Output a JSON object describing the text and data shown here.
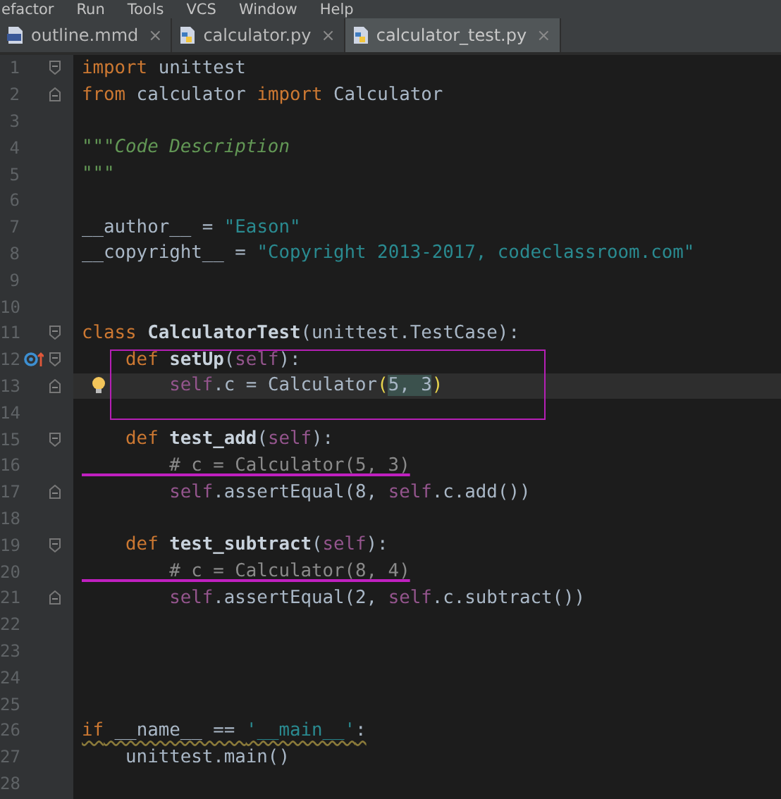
{
  "menu": [
    "efactor",
    "Run",
    "Tools",
    "VCS",
    "Window",
    "Help"
  ],
  "tabs": [
    {
      "label": "outline.mmd",
      "close": "×",
      "selected": false
    },
    {
      "label": "calculator.py",
      "close": "×",
      "selected": false
    },
    {
      "label": "calculator_test.py",
      "close": "×",
      "selected": true
    }
  ],
  "editor": {
    "lines": [
      {
        "number": "1",
        "fold_start": true,
        "tokens": [
          {
            "text": "import",
            "kind": "keyword"
          },
          {
            "text": " unittest",
            "kind": "plain"
          }
        ]
      },
      {
        "number": "2",
        "fold_end": true,
        "tokens": [
          {
            "text": "from",
            "kind": "keyword"
          },
          {
            "text": " calculator ",
            "kind": "plain"
          },
          {
            "text": "import",
            "kind": "keyword"
          },
          {
            "text": " Calculator",
            "kind": "plain"
          }
        ]
      },
      {
        "number": "3"
      },
      {
        "number": "4",
        "tokens": [
          {
            "text": "\"\"\"Code Description",
            "kind": "docstring"
          }
        ]
      },
      {
        "number": "5",
        "tokens": [
          {
            "text": "\"\"\"",
            "kind": "docstring"
          }
        ]
      },
      {
        "number": "6"
      },
      {
        "number": "7",
        "tokens": [
          {
            "text": "__author__ = ",
            "kind": "plain"
          },
          {
            "text": "\"Eason\"",
            "kind": "string"
          }
        ]
      },
      {
        "number": "8",
        "tokens": [
          {
            "text": "__copyright__ = ",
            "kind": "plain"
          },
          {
            "text": "\"Copyright 2013-2017, codeclassroom.com\"",
            "kind": "string"
          }
        ]
      },
      {
        "number": "9"
      },
      {
        "number": "10"
      },
      {
        "number": "11",
        "fold_start": true,
        "tokens": [
          {
            "text": "class",
            "kind": "keyword"
          },
          {
            "text": " CalculatorTest",
            "kind": "name"
          },
          {
            "text": "(unittest.TestCase):",
            "kind": "plain"
          }
        ]
      },
      {
        "number": "12",
        "fold_start": true,
        "override_marker": true,
        "boxed": true,
        "tokens": [
          {
            "text": "    def",
            "kind": "keyword"
          },
          {
            "text": " setUp",
            "kind": "name"
          },
          {
            "text": "(",
            "kind": "plain"
          },
          {
            "text": "self",
            "kind": "self"
          },
          {
            "text": "):",
            "kind": "plain"
          }
        ]
      },
      {
        "number": "13",
        "fold_end": true,
        "intention_bulb": true,
        "boxed": true,
        "current": true,
        "tokens": [
          {
            "text": "        self",
            "kind": "self"
          },
          {
            "text": ".c = Calculator",
            "kind": "plain"
          },
          {
            "text": "(",
            "kind": "brace"
          },
          {
            "text": "5, 3",
            "kind": "matched"
          },
          {
            "text": ")",
            "kind": "brace"
          }
        ]
      },
      {
        "number": "14",
        "boxed": true
      },
      {
        "number": "15",
        "fold_start": true,
        "tokens": [
          {
            "text": "    def",
            "kind": "keyword"
          },
          {
            "text": " test_add",
            "kind": "name"
          },
          {
            "text": "(",
            "kind": "plain"
          },
          {
            "text": "self",
            "kind": "self"
          },
          {
            "text": "):",
            "kind": "plain"
          }
        ]
      },
      {
        "number": "16",
        "struck": true,
        "tokens": [
          {
            "text": "        # c = Calculator(5, 3)",
            "kind": "comment"
          }
        ]
      },
      {
        "number": "17",
        "fold_end": true,
        "tokens": [
          {
            "text": "        self",
            "kind": "self"
          },
          {
            "text": ".assertEqual(8, ",
            "kind": "plain"
          },
          {
            "text": "self",
            "kind": "self"
          },
          {
            "text": ".c.add())",
            "kind": "plain"
          }
        ]
      },
      {
        "number": "18"
      },
      {
        "number": "19",
        "fold_start": true,
        "tokens": [
          {
            "text": "    def",
            "kind": "keyword"
          },
          {
            "text": " test_subtract",
            "kind": "name"
          },
          {
            "text": "(",
            "kind": "plain"
          },
          {
            "text": "self",
            "kind": "self"
          },
          {
            "text": "):",
            "kind": "plain"
          }
        ]
      },
      {
        "number": "20",
        "struck": true,
        "tokens": [
          {
            "text": "        # c = Calculator(8, 4)",
            "kind": "comment"
          }
        ]
      },
      {
        "number": "21",
        "fold_end": true,
        "tokens": [
          {
            "text": "        self",
            "kind": "self"
          },
          {
            "text": ".assertEqual(2, ",
            "kind": "plain"
          },
          {
            "text": "self",
            "kind": "self"
          },
          {
            "text": ".c.subtract())",
            "kind": "plain"
          }
        ]
      },
      {
        "number": "22"
      },
      {
        "number": "23"
      },
      {
        "number": "24"
      },
      {
        "number": "25"
      },
      {
        "number": "26",
        "warning": true,
        "tokens": [
          {
            "text": "if",
            "kind": "keyword"
          },
          {
            "text": " __name__ == ",
            "kind": "plain"
          },
          {
            "text": "'__main__'",
            "kind": "string"
          },
          {
            "text": ":",
            "kind": "plain"
          }
        ]
      },
      {
        "number": "27",
        "tokens": [
          {
            "text": "    unittest.main()",
            "kind": "plain"
          }
        ]
      },
      {
        "number": "28"
      }
    ]
  }
}
